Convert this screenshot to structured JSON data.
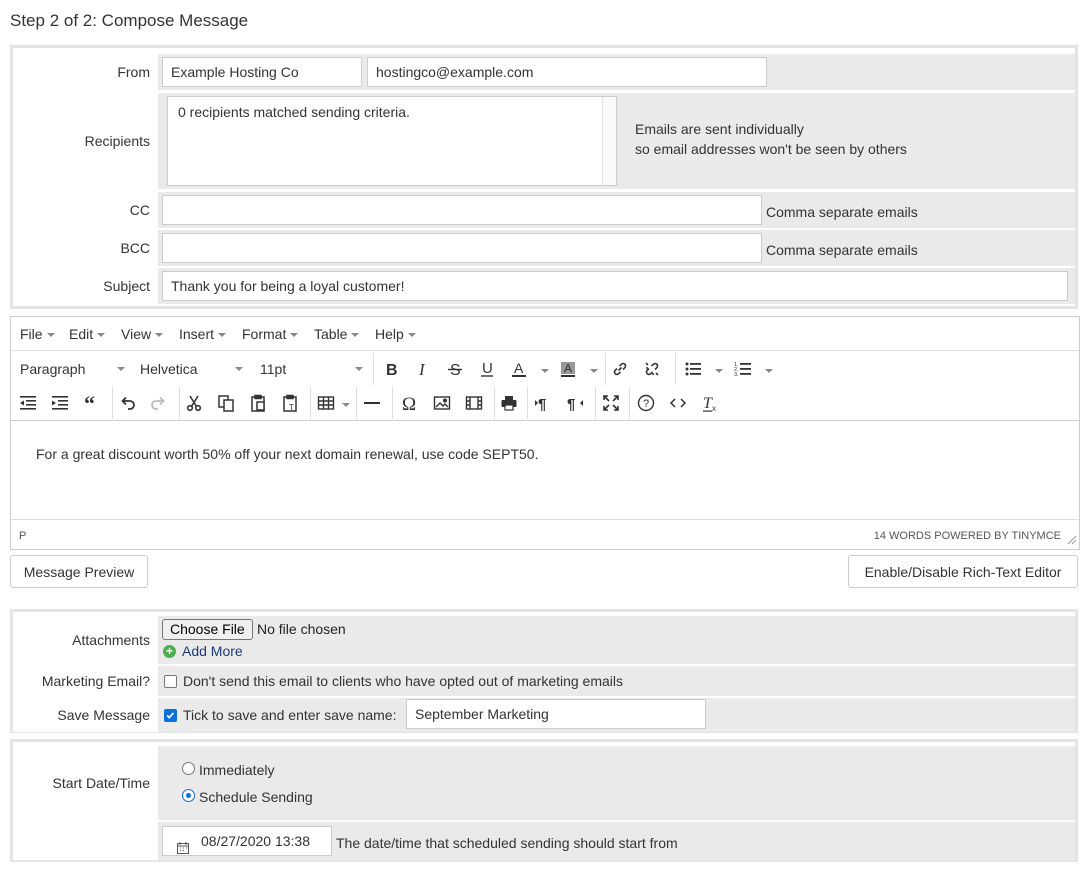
{
  "page_title": "Step 2 of 2: Compose Message",
  "from": {
    "label": "From",
    "name_value": "Example Hosting Co",
    "email_value": "hostingco@example.com"
  },
  "recipients": {
    "label": "Recipients",
    "value": "0 recipients matched sending criteria.",
    "note_line1": "Emails are sent individually",
    "note_line2": "so email addresses won't be seen by others"
  },
  "cc": {
    "label": "CC",
    "value": "",
    "hint": "Comma separate emails"
  },
  "bcc": {
    "label": "BCC",
    "value": "",
    "hint": "Comma separate emails"
  },
  "subject": {
    "label": "Subject",
    "value": "Thank you for being a loyal customer!"
  },
  "editor": {
    "menus": [
      "File",
      "Edit",
      "View",
      "Insert",
      "Format",
      "Table",
      "Help"
    ],
    "block_format": "Paragraph",
    "font_family": "Helvetica",
    "font_size": "11pt",
    "body": "For a great discount worth 50% off your next domain renewal, use code SEPT50.",
    "status_path": "P",
    "status_right": "14 WORDS POWERED BY TINYMCE"
  },
  "buttons": {
    "preview": "Message Preview",
    "toggle_editor": "Enable/Disable Rich-Text Editor"
  },
  "attachments": {
    "label": "Attachments",
    "choose_file": "Choose File",
    "no_file": "No file chosen",
    "add_more": "Add More"
  },
  "marketing": {
    "label": "Marketing Email?",
    "checkbox_label": "Don't send this email to clients who have opted out of marketing emails",
    "checked": false
  },
  "save_message": {
    "label": "Save Message",
    "checkbox_label": "Tick to save and enter save name:",
    "checked": true,
    "name_value": "September Marketing"
  },
  "start": {
    "label": "Start Date/Time",
    "option_immediately": "Immediately",
    "option_schedule": "Schedule Sending",
    "selected": "schedule",
    "datetime_value": "08/27/2020 13:38",
    "datetime_hint": "The date/time that scheduled sending should start from"
  },
  "colors": {
    "accent_blue": "#0b6fe0",
    "field_bg": "#eaeaea",
    "panel_border": "#e1e6e2",
    "add_more_green": "#4caf50"
  }
}
